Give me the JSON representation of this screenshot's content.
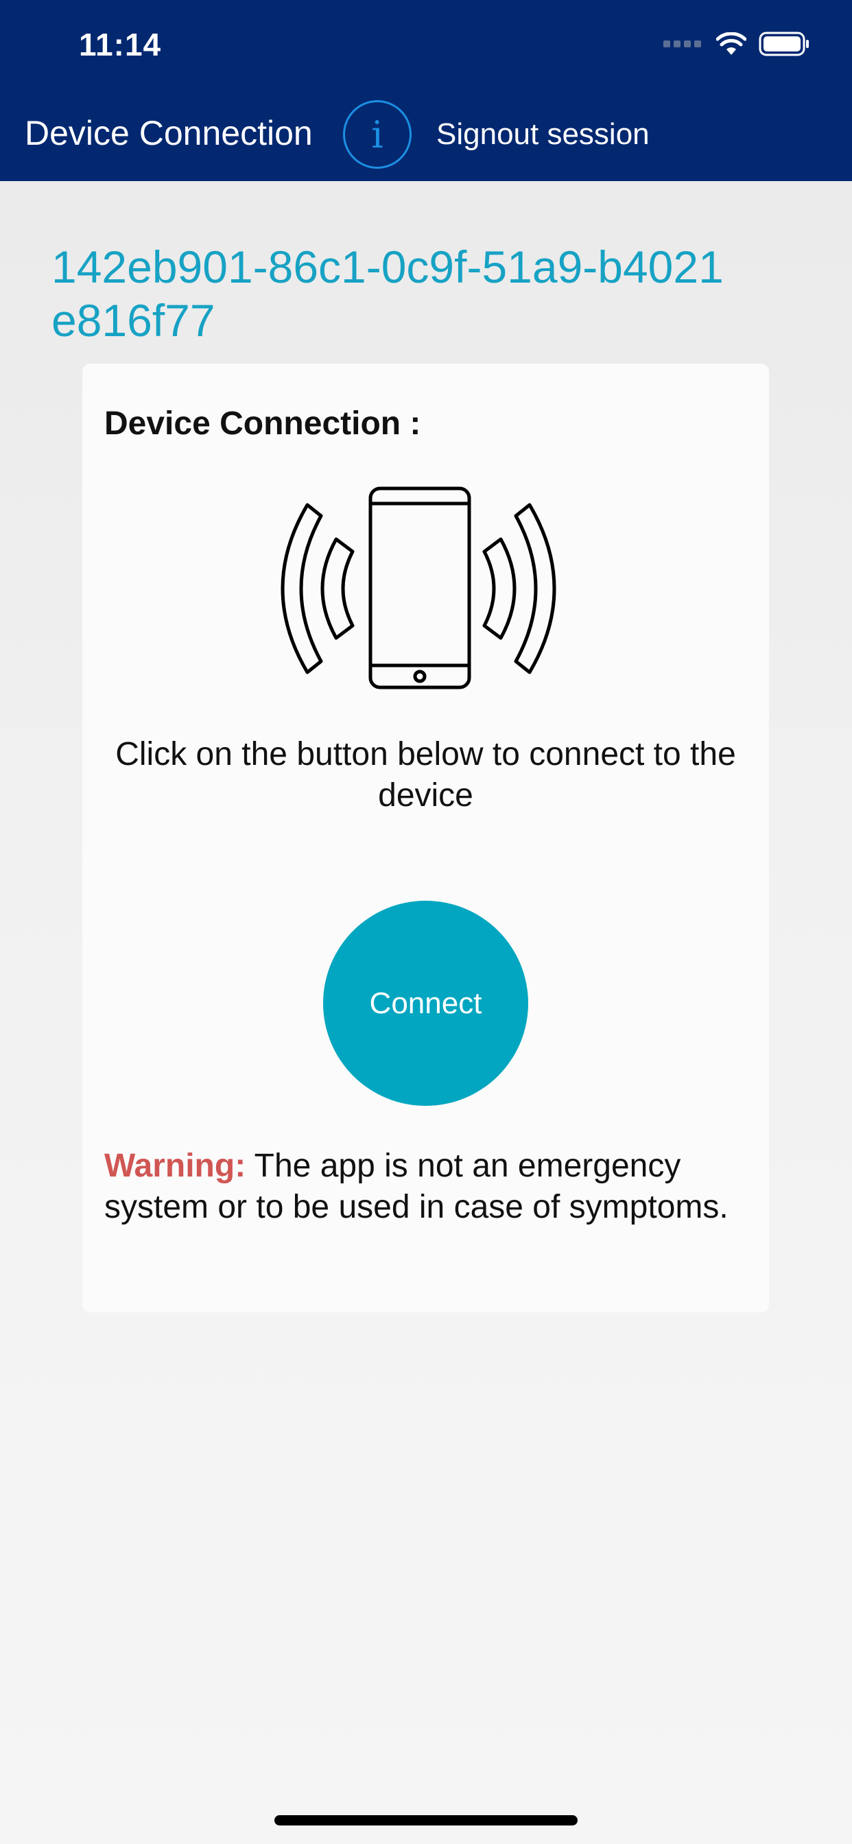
{
  "status_bar": {
    "time": "11:14",
    "icons": [
      "cellular-signal-icon",
      "wifi-icon",
      "battery-icon"
    ]
  },
  "nav": {
    "title": "Device Connection",
    "info_icon_glyph": "i",
    "signout_label": "Signout session"
  },
  "device": {
    "id": "142eb901-86c1-0c9f-51a9-b4021e816f77"
  },
  "card": {
    "title": "Device Connection :",
    "illustration_icon": "phone-vibrating-icon",
    "instruction": "Click on the button below to connect to the device",
    "connect_label": "Connect",
    "warning_label": "Warning:",
    "warning_text": "The app is not an emergency system or to be used in case of symptoms."
  },
  "colors": {
    "header_bg": "#042870",
    "accent": "#02a6c0",
    "device_id": "#17a2c4",
    "info_ring": "#1c8fe2",
    "warning": "#d05654"
  }
}
